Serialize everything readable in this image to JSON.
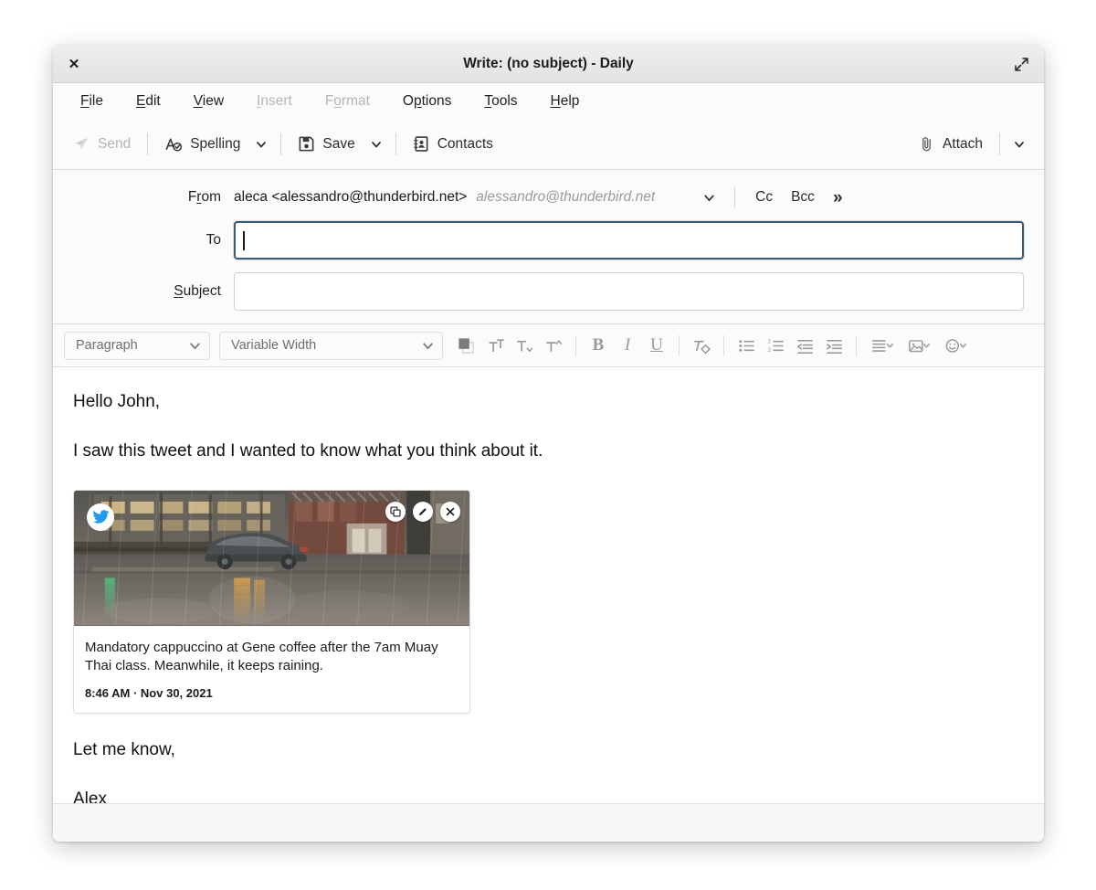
{
  "window": {
    "title": "Write: (no subject) - Daily",
    "close_icon": "close-icon",
    "maximize_icon": "maximize-icon"
  },
  "menubar": {
    "items": [
      {
        "label": "File",
        "mnemonic": "F",
        "disabled": false
      },
      {
        "label": "Edit",
        "mnemonic": "E",
        "disabled": false
      },
      {
        "label": "View",
        "mnemonic": "V",
        "disabled": false
      },
      {
        "label": "Insert",
        "mnemonic": "I",
        "disabled": true
      },
      {
        "label": "Format",
        "mnemonic": "o",
        "disabled": true
      },
      {
        "label": "Options",
        "mnemonic": "p",
        "disabled": false
      },
      {
        "label": "Tools",
        "mnemonic": "T",
        "disabled": false
      },
      {
        "label": "Help",
        "mnemonic": "H",
        "disabled": false
      }
    ]
  },
  "toolbar": {
    "send_label": "Send",
    "send_disabled": true,
    "spelling_label": "Spelling",
    "save_label": "Save",
    "contacts_label": "Contacts",
    "attach_label": "Attach",
    "icons": {
      "send": "send-paper-plane-icon",
      "spelling": "spellcheck-icon",
      "save": "floppy-disk-icon",
      "contacts": "address-book-icon",
      "attach": "paperclip-icon",
      "dropdown": "chevron-down-icon"
    }
  },
  "headers": {
    "from_label": "From",
    "from_mnemonic": "r",
    "from_value": "aleca <alessandro@thunderbird.net>",
    "from_alias": "alessandro@thunderbird.net",
    "to_label": "To",
    "to_value": "",
    "to_placeholder": "",
    "subject_label": "Subject",
    "subject_mnemonic": "S",
    "subject_value": "",
    "subject_placeholder": "",
    "cc_label": "Cc",
    "bcc_label": "Bcc",
    "more_label": "»"
  },
  "format_toolbar": {
    "paragraph_style": "Paragraph",
    "font_family": "Variable Width",
    "buttons": [
      {
        "name": "text-color-swatch",
        "title": "Text Color"
      },
      {
        "name": "increase-font-size-icon",
        "title": "Increase Font Size"
      },
      {
        "name": "decrease-font-size-icon",
        "title": "Decrease Font Size"
      },
      {
        "name": "font-size-icon",
        "title": "Font Size"
      },
      {
        "name": "bold-icon",
        "title": "Bold"
      },
      {
        "name": "italic-icon",
        "title": "Italic"
      },
      {
        "name": "underline-icon",
        "title": "Underline"
      },
      {
        "name": "remove-formatting-icon",
        "title": "Remove Text Styling"
      },
      {
        "name": "bullet-list-icon",
        "title": "Unordered List"
      },
      {
        "name": "numbered-list-icon",
        "title": "Ordered List"
      },
      {
        "name": "outdent-icon",
        "title": "Decrease Indent"
      },
      {
        "name": "indent-icon",
        "title": "Increase Indent"
      },
      {
        "name": "align-icon",
        "title": "Align"
      },
      {
        "name": "insert-image-icon",
        "title": "Insert Image"
      },
      {
        "name": "emoji-icon",
        "title": "Insert Smiley"
      }
    ],
    "labels": {
      "bold": "B",
      "italic": "I",
      "underline": "U"
    }
  },
  "message": {
    "greeting": "Hello John,",
    "line1": "I saw this tweet and I wanted to know what you think about it.",
    "closing": "Let me know,",
    "signature": "Alex"
  },
  "tweet_card": {
    "text": "Mandatory cappuccino at Gene coffee after the 7am Muay Thai class. Meanwhile, it keeps raining.",
    "timestamp": "8:46 AM · Nov 30, 2021",
    "logo_icon": "twitter-bird-icon",
    "actions": [
      {
        "name": "duplicate-icon",
        "title": "Copy"
      },
      {
        "name": "edit-pencil-icon",
        "title": "Edit"
      },
      {
        "name": "close-icon",
        "title": "Remove"
      }
    ],
    "media_alt": "Rainy city street at dusk with a parked car and wet reflections"
  },
  "colors": {
    "accent_focus": "#3c5a74",
    "twitter_blue": "#1d9bf0",
    "toolbar_bg": "#fbfbfb",
    "titlebar_bg": "#e7e7e7",
    "disabled_text": "#b6b6b6"
  }
}
